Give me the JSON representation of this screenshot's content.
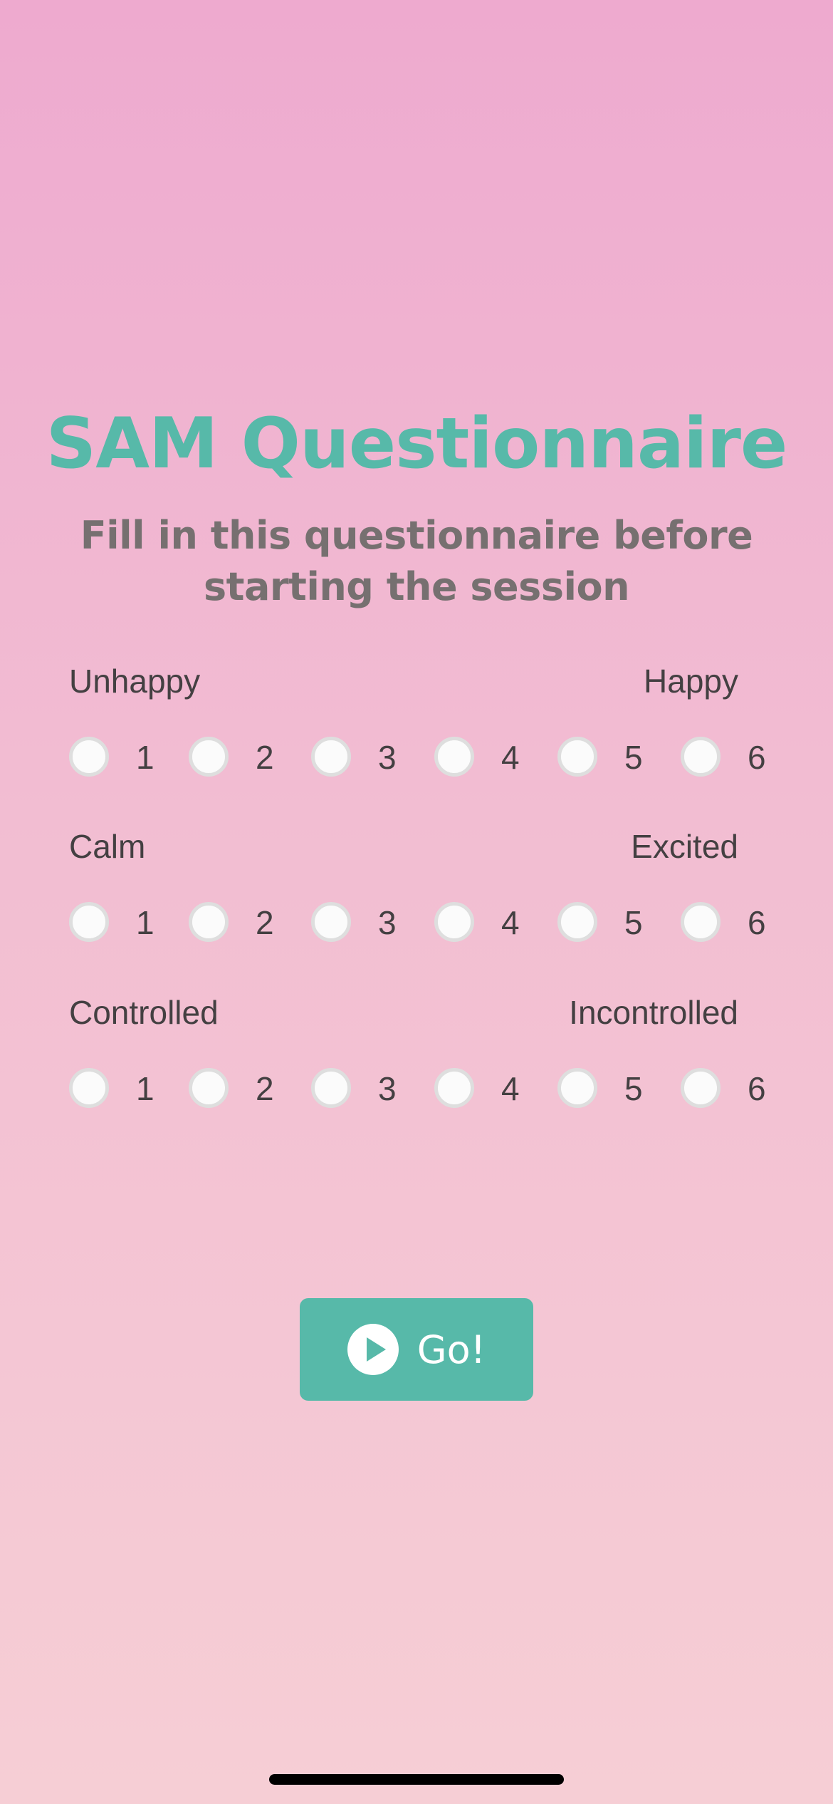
{
  "header": {
    "title": "SAM Questionnaire",
    "subtitle": "Fill in this questionnaire before starting the session"
  },
  "scales": [
    {
      "left_label": "Unhappy",
      "right_label": "Happy",
      "options": [
        "1",
        "2",
        "3",
        "4",
        "5",
        "6"
      ],
      "selected": null
    },
    {
      "left_label": "Calm",
      "right_label": "Excited",
      "options": [
        "1",
        "2",
        "3",
        "4",
        "5",
        "6"
      ],
      "selected": null
    },
    {
      "left_label": "Controlled",
      "right_label": "Incontrolled",
      "options": [
        "1",
        "2",
        "3",
        "4",
        "5",
        "6"
      ],
      "selected": null
    }
  ],
  "go_button": {
    "label": "Go!",
    "icon": "play-circle-icon"
  },
  "colors": {
    "accent": "#57b9a9",
    "subtitle": "#767070",
    "text": "#444042",
    "background_top": "#eeaacf",
    "background_bottom": "#f6ced5"
  }
}
